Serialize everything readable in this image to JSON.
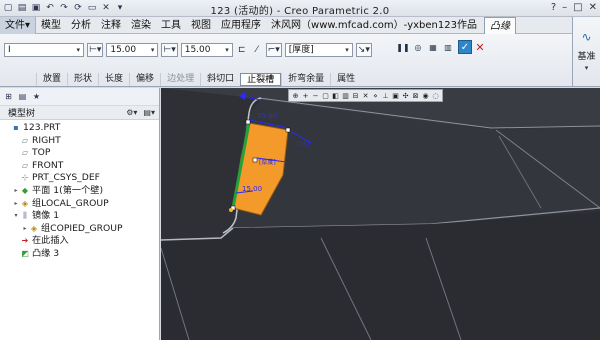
{
  "window": {
    "title": "123 (活动的) - Creo Parametric 2.0",
    "controls": [
      "?",
      "–",
      "□",
      "✕"
    ]
  },
  "menu": {
    "items": [
      "文件▾",
      "模型",
      "分析",
      "注释",
      "渲染",
      "工具",
      "视图",
      "应用程序",
      "沐风网（www.mfcad.com）-yxben123作品"
    ],
    "active_tab": "凸缘"
  },
  "dashboard": {
    "shape_value": "I",
    "length1_value": "15.00",
    "length2_value": "15.00",
    "thickness_placeholder": "[厚度]",
    "thickness_dd": "▾",
    "tabs": [
      {
        "label": "放置",
        "state": "normal"
      },
      {
        "label": "形状",
        "state": "normal"
      },
      {
        "label": "长度",
        "state": "normal"
      },
      {
        "label": "偏移",
        "state": "normal"
      },
      {
        "label": "边处理",
        "state": "dim"
      },
      {
        "label": "斜切口",
        "state": "normal"
      },
      {
        "label": "止裂槽",
        "state": "selected"
      },
      {
        "label": "折弯余量",
        "state": "normal"
      },
      {
        "label": "属性",
        "state": "normal"
      }
    ]
  },
  "datum_panel": {
    "icon": "datum-icon",
    "label": "基准",
    "dd": "▾"
  },
  "model_tree": {
    "title": "模型树",
    "nodes": [
      {
        "label": "123.PRT",
        "level": 0,
        "icon": "part-icon",
        "expand": ""
      },
      {
        "label": "RIGHT",
        "level": 1,
        "icon": "plane-icon",
        "expand": ""
      },
      {
        "label": "TOP",
        "level": 1,
        "icon": "plane-icon",
        "expand": ""
      },
      {
        "label": "FRONT",
        "level": 1,
        "icon": "plane-icon",
        "expand": ""
      },
      {
        "label": "PRT_CSYS_DEF",
        "level": 1,
        "icon": "csys-icon",
        "expand": ""
      },
      {
        "label": "平面 1(第一个壁)",
        "level": 1,
        "icon": "wall-icon",
        "expand": "▸"
      },
      {
        "label": "组LOCAL_GROUP",
        "level": 1,
        "icon": "group-icon",
        "expand": "▸"
      },
      {
        "label": "镜像 1",
        "level": 1,
        "icon": "mirror-icon",
        "expand": "▾"
      },
      {
        "label": "组COPIED_GROUP",
        "level": 2,
        "icon": "group-icon",
        "expand": "▸"
      },
      {
        "label": "在此插入",
        "level": 1,
        "icon": "insert-arrow-icon",
        "expand": ""
      },
      {
        "label": "凸缘 3",
        "level": 1,
        "icon": "flange-icon",
        "expand": ""
      }
    ]
  },
  "graphics": {
    "dim_upper": "15.00",
    "dim_lower": "15.00",
    "dim_thickness": "[厚度]",
    "dim_right": "[15]"
  },
  "colors": {
    "accent": "#2c86c9",
    "flange_fill": "#f39a2a",
    "viewport_bg": "#2f3036",
    "edge_green": "#21a33a",
    "dim_blue": "#2a2aff"
  }
}
